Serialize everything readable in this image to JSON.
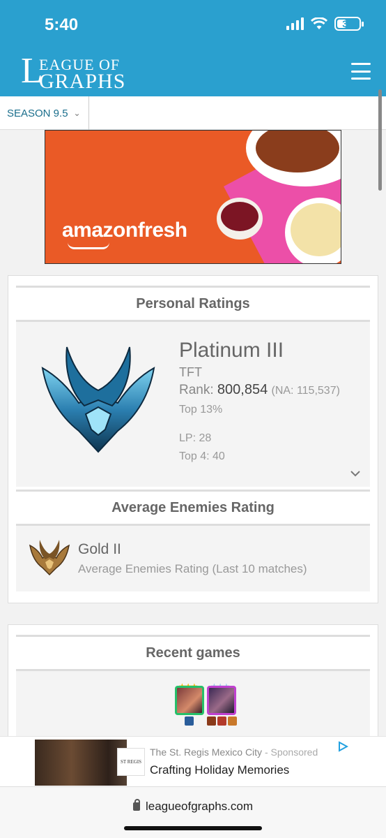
{
  "status_bar": {
    "time": "5:40",
    "battery": "37"
  },
  "header": {
    "logo_line1": "EAGUE OF",
    "logo_line2": "GRAPHS",
    "logo_big_letter": "L"
  },
  "season_selector": {
    "value": "SEASON 9.5"
  },
  "top_ad": {
    "brand": "amazonfresh"
  },
  "personal_ratings": {
    "title": "Personal Ratings",
    "tier": "Platinum III",
    "queue": "TFT",
    "rank_label": "Rank:",
    "rank_value": "800,854",
    "rank_region": "(NA: 115,537)",
    "top_percent": "Top 13%",
    "lp": "LP: 28",
    "top4": "Top 4: 40"
  },
  "average_enemies": {
    "title": "Average Enemies Rating",
    "tier": "Gold II",
    "subtitle": "Average Enemies Rating (Last 10 matches)"
  },
  "recent_games": {
    "title": "Recent games"
  },
  "bottom_ad": {
    "advertiser": "The St. Regis Mexico City",
    "sponsored": "Sponsored",
    "headline": "Crafting Holiday Memories",
    "logo_text": "ST REGIS"
  },
  "browser": {
    "url": "leagueofgraphs.com"
  },
  "colors": {
    "brand_blue": "#2aa0cf",
    "ad_orange": "#ea5a26"
  }
}
